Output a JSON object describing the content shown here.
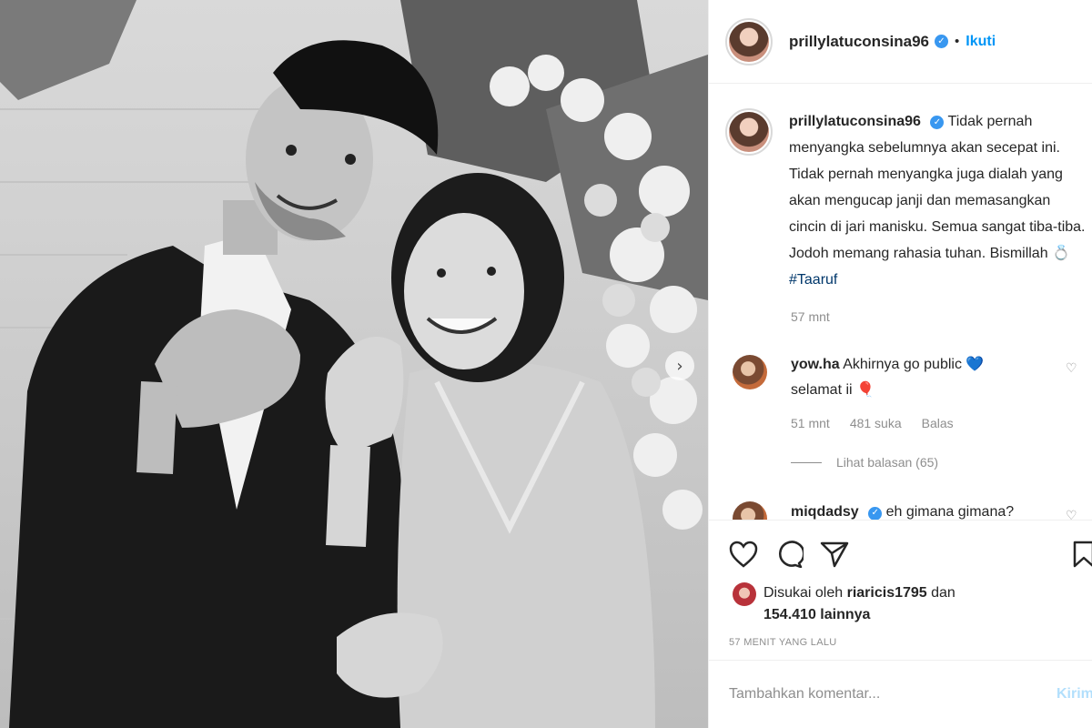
{
  "post": {
    "username": "prillylatuconsina96",
    "separator": "•",
    "follow_label": "Ikuti",
    "caption_parts": [
      "Tidak pernah menyangka sebelumnya akan secepat ini. Tidak pernah menyangka juga dialah yang akan mengucap janji dan memasangkan cincin di jari manisku. Semua sangat tiba-tiba. Jodoh memang rahasia tuhan. Bismillah ",
      "💍"
    ],
    "hashtag": "#Taaruf",
    "caption_time": "57 mnt"
  },
  "comments": [
    {
      "username": "yow.ha",
      "text": "Akhirnya go public ",
      "emoji": "💙",
      "text2": "selamat ii ",
      "emoji2": "🎈",
      "time": "51 mnt",
      "likes": "481 suka",
      "reply_label": "Balas",
      "view_replies": "Lihat balasan (65)"
    },
    {
      "username": "miqdadsy",
      "text": "eh gimana gimana?"
    }
  ],
  "likes": {
    "prefix": "Disukai oleh ",
    "user": "riaricis1795",
    "middle": " dan",
    "count": "154.410 lainnya"
  },
  "time_ago": "57 MENIT YANG LALU",
  "add_comment": {
    "placeholder": "Tambahkan komentar...",
    "post_label": "Kirim"
  },
  "icons": {
    "verified": "✓",
    "carousel_next": "›",
    "comment_like": "♡"
  },
  "colors": {
    "accent": "#0095f6",
    "verified": "#3897f0",
    "hashtag": "#00376b",
    "muted": "#8e8e8e"
  }
}
